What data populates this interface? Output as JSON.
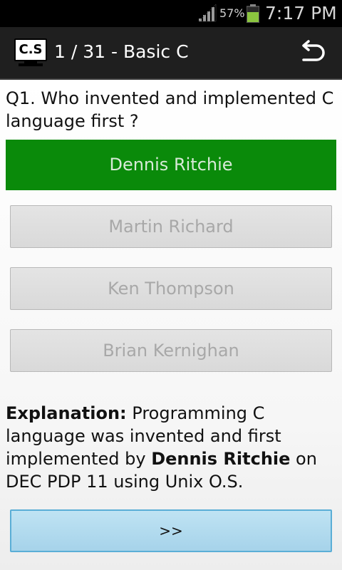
{
  "status_bar": {
    "battery_percent": "57%",
    "time": "7:17 PM",
    "icons": [
      "signal-icon",
      "battery-icon"
    ]
  },
  "action_bar": {
    "app_icon_text": "C.S",
    "title": "1 / 31 - Basic C",
    "back_icon": "back-arrow-icon"
  },
  "question": {
    "text": "Q1. Who invented and implemented C language first ?"
  },
  "options": [
    {
      "label": "Dennis Ritchie",
      "state": "correct"
    },
    {
      "label": "Martin Richard",
      "state": "disabled"
    },
    {
      "label": "Ken Thompson",
      "state": "disabled"
    },
    {
      "label": "Brian Kernighan",
      "state": "disabled"
    }
  ],
  "explanation": {
    "heading": "Explanation:",
    "text_before": " Programming C language was invented and first implemented by ",
    "highlight": "Dennis Ritchie",
    "text_after": " on DEC PDP 11 using Unix O.S."
  },
  "next_button": {
    "label": ">>"
  },
  "colors": {
    "correct_green": "#0a8a0a",
    "next_blue": "#a6d3ea",
    "action_bar": "#1f1f1f",
    "status_bar": "#000000"
  }
}
